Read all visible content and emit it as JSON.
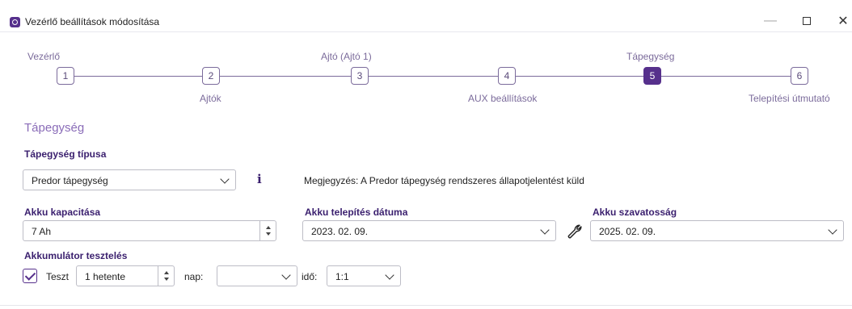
{
  "window": {
    "title": "Vezérlő beállítások módosítása",
    "controls": {
      "minimize": "—",
      "maximize": "□",
      "close": "✕"
    }
  },
  "stepper": {
    "steps": [
      {
        "number": "1",
        "label": "Vezérlő"
      },
      {
        "number": "2",
        "label": "Ajtók"
      },
      {
        "number": "3",
        "label": "Ajtó (Ajtó 1)"
      },
      {
        "number": "4",
        "label": "AUX beállítások"
      },
      {
        "number": "5",
        "label": "Tápegység"
      },
      {
        "number": "6",
        "label": "Telepítési útmutató"
      }
    ],
    "active_step": 5
  },
  "section": {
    "title": "Tápegység",
    "power_type_label": "Tápegység típusa",
    "power_type_value": "Predor tápegység",
    "note": "Megjegyzés: A Predor tápegység rendszeres állapotjelentést küld",
    "battery_capacity_label": "Akku kapacitása",
    "battery_capacity_value": "7 Ah",
    "install_date_label": "Akku telepítés dátuma",
    "install_date_value": "2023. 02. 09.",
    "warranty_label": "Akku szavatosság",
    "warranty_value": "2025. 02. 09.",
    "battery_test_label": "Akkumulátor tesztelés",
    "test_checkbox_label": "Teszt",
    "test_checked": true,
    "test_frequency_value": "1 hetente",
    "day_label": "nap:",
    "day_value": "",
    "time_label": "idő:",
    "time_value": "1:1"
  },
  "icons": {
    "app": "app-logo-icon",
    "info": "info-icon",
    "wrench": "wrench-icon",
    "chevron": "chevron-down-icon"
  },
  "colors": {
    "accent": "#56308c",
    "step_text": "#7b6b9b",
    "label_text": "#3a1f6e"
  }
}
